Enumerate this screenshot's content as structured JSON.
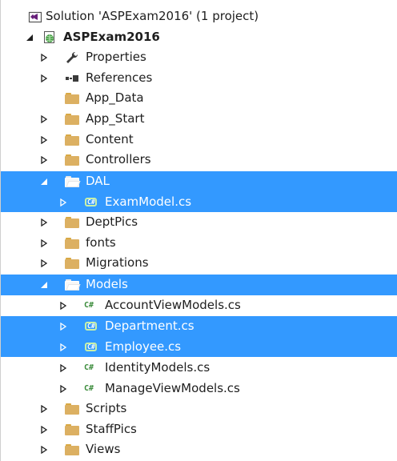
{
  "solution": {
    "label": "Solution 'ASPExam2016' (1 project)"
  },
  "project": {
    "label": "ASPExam2016"
  },
  "colors": {
    "selection": "#3399ff",
    "folder": "#dcb062",
    "cs_green": "#3c8c3c"
  },
  "items": {
    "properties": "Properties",
    "references": "References",
    "app_data": "App_Data",
    "app_start": "App_Start",
    "content": "Content",
    "controllers": "Controllers",
    "dal": "DAL",
    "exammodel": "ExamModel.cs",
    "deptpics": "DeptPics",
    "fonts": "fonts",
    "migrations": "Migrations",
    "models": "Models",
    "accountviewmodels": "AccountViewModels.cs",
    "department": "Department.cs",
    "employee": "Employee.cs",
    "identitymodels": "IdentityModels.cs",
    "manageviewmodels": "ManageViewModels.cs",
    "scripts": "Scripts",
    "staffpics": "StaffPics",
    "views": "Views"
  },
  "icons": {
    "cs_glyph": "C#",
    "class_glyph": "C#"
  }
}
